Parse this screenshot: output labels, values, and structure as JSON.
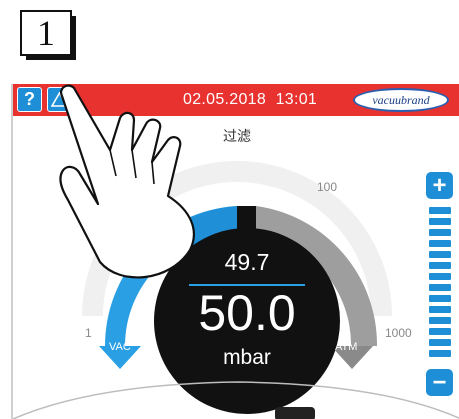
{
  "step": {
    "number": "1"
  },
  "header": {
    "help_glyph": "?",
    "help_icon": "help-icon",
    "alert_icon": "warning-triangle-icon",
    "date": "02.05.2018",
    "time": "13:01",
    "logo_text": "vacuubrand"
  },
  "mode": {
    "label": "过滤"
  },
  "gauge": {
    "scale_min_label": "1",
    "scale_mid_label": "100",
    "scale_max_label": "1000",
    "vac_label": "VAC",
    "atm_label": "ATM",
    "setpoint": "49.7",
    "value": "50.0",
    "unit": "mbar",
    "colors": {
      "active": "#2a9fe3",
      "inactive": "#9e9e9e",
      "dial": "#111111",
      "accent": "#e8322f"
    }
  },
  "slider": {
    "plus_glyph": "+",
    "minus_glyph": "−",
    "plus_icon": "plus-icon",
    "minus_icon": "minus-icon"
  }
}
